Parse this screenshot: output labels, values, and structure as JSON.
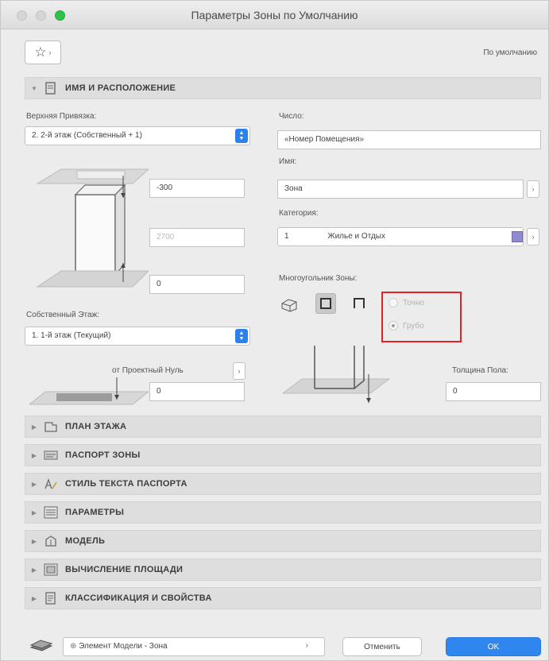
{
  "window": {
    "title": "Параметры Зоны по Умолчанию"
  },
  "toolbar": {
    "favorites_icon": "star-icon",
    "default_label": "По умолчанию"
  },
  "sections": {
    "name_location": "ИМЯ И РАСПОЛОЖЕНИЕ",
    "collapsed": [
      {
        "label": "ПЛАН ЭТАЖА",
        "icon": "floor-plan-icon"
      },
      {
        "label": "ПАСПОРТ ЗОНЫ",
        "icon": "zone-stamp-icon"
      },
      {
        "label": "СТИЛЬ ТЕКСТА ПАСПОРТА",
        "icon": "text-style-icon"
      },
      {
        "label": "ПАРАМЕТРЫ",
        "icon": "parameters-icon"
      },
      {
        "label": "МОДЕЛЬ",
        "icon": "model-icon"
      },
      {
        "label": "ВЫЧИСЛЕНИЕ ПЛОЩАДИ",
        "icon": "area-calc-icon"
      },
      {
        "label": "КЛАССИФИКАЦИЯ И СВОЙСТВА",
        "icon": "classification-icon"
      }
    ]
  },
  "left": {
    "top_link_label": "Верхняя Привязка:",
    "top_link_value": "2. 2-й этаж (Собственный + 1)",
    "offset_top": "-300",
    "height": "2700",
    "offset_bottom": "0",
    "home_story_label": "Собственный Этаж:",
    "home_story_value": "1. 1-й этаж (Текущий)",
    "project_zero_label": "от Проектный Нуль",
    "project_zero_value": "0"
  },
  "right": {
    "number_label": "Число:",
    "number_value": "«Номер Помещения»",
    "name_label": "Имя:",
    "name_value": "Зона",
    "category_label": "Категория:",
    "category_code": "1",
    "category_value": "Жилье и Отдых",
    "category_color": "#8f8bcf",
    "polygons_label": "Многоугольник Зоны:",
    "radio_precise": "Точно",
    "radio_gross": "Грубо",
    "radio_selected": "Грубо",
    "floor_thickness_label": "Толщина Пола:",
    "floor_thickness_value": "0"
  },
  "footer": {
    "element_label": "Элемент Модели - Зона",
    "cancel": "Отменить",
    "ok": "OK"
  },
  "colors": {
    "accent": "#2f86ee",
    "highlight": "#e02222"
  }
}
